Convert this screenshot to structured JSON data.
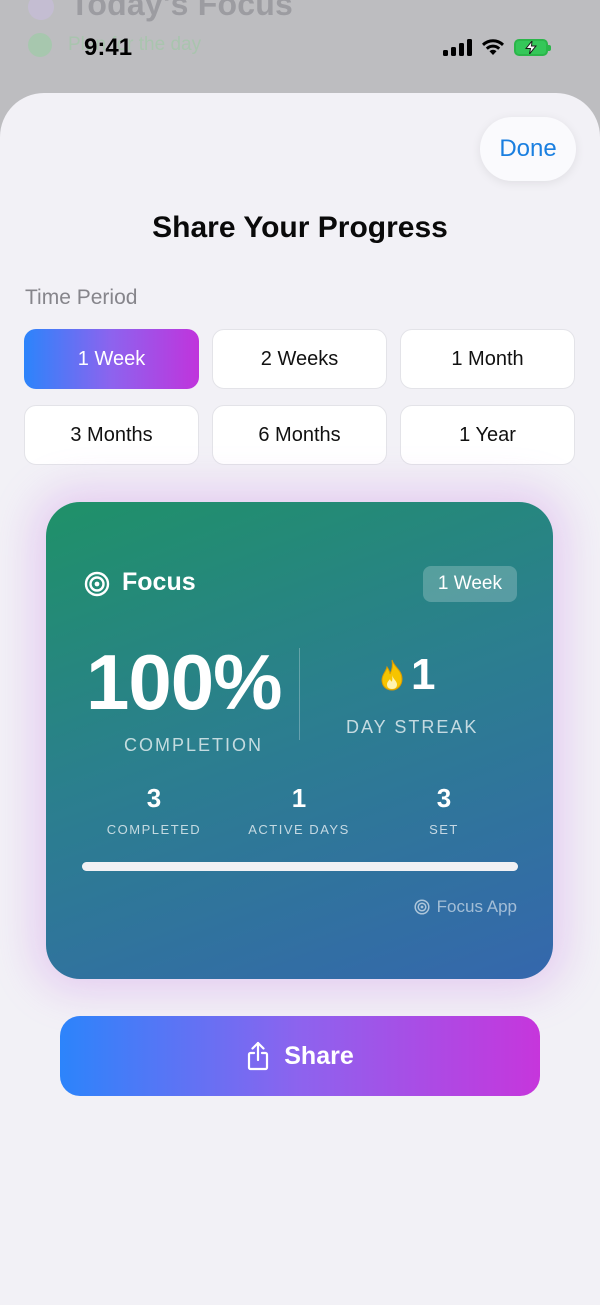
{
  "background": {
    "title": "Today's Focus",
    "subtitle": "Plan for the day"
  },
  "status_bar": {
    "time": "9:41",
    "icons": [
      "cellular-signal-icon",
      "wifi-icon",
      "battery-charging-icon"
    ]
  },
  "sheet": {
    "done_label": "Done",
    "title": "Share Your Progress",
    "time_period_label": "Time Period",
    "periods": [
      {
        "label": "1 Week",
        "selected": true
      },
      {
        "label": "2 Weeks",
        "selected": false
      },
      {
        "label": "1 Month",
        "selected": false
      },
      {
        "label": "3 Months",
        "selected": false
      },
      {
        "label": "6 Months",
        "selected": false
      },
      {
        "label": "1 Year",
        "selected": false
      }
    ]
  },
  "card": {
    "app_name": "Focus",
    "period_badge": "1 Week",
    "completion_value": "100%",
    "completion_label": "COMPLETION",
    "streak_value": "1",
    "streak_label": "DAY STREAK",
    "stats": [
      {
        "value": "3",
        "label": "COMPLETED"
      },
      {
        "value": "1",
        "label": "ACTIVE DAYS"
      },
      {
        "value": "3",
        "label": "SET"
      }
    ],
    "progress_fraction": 1.0,
    "footer_brand": "Focus App"
  },
  "share_button_label": "Share",
  "colors": {
    "accent_blue": "#2c84fb",
    "accent_purple": "#8d63ee",
    "accent_magenta": "#c034dc",
    "card_green": "#1f9168",
    "card_blue": "#3567ad",
    "done_blue": "#1a7fe0"
  }
}
